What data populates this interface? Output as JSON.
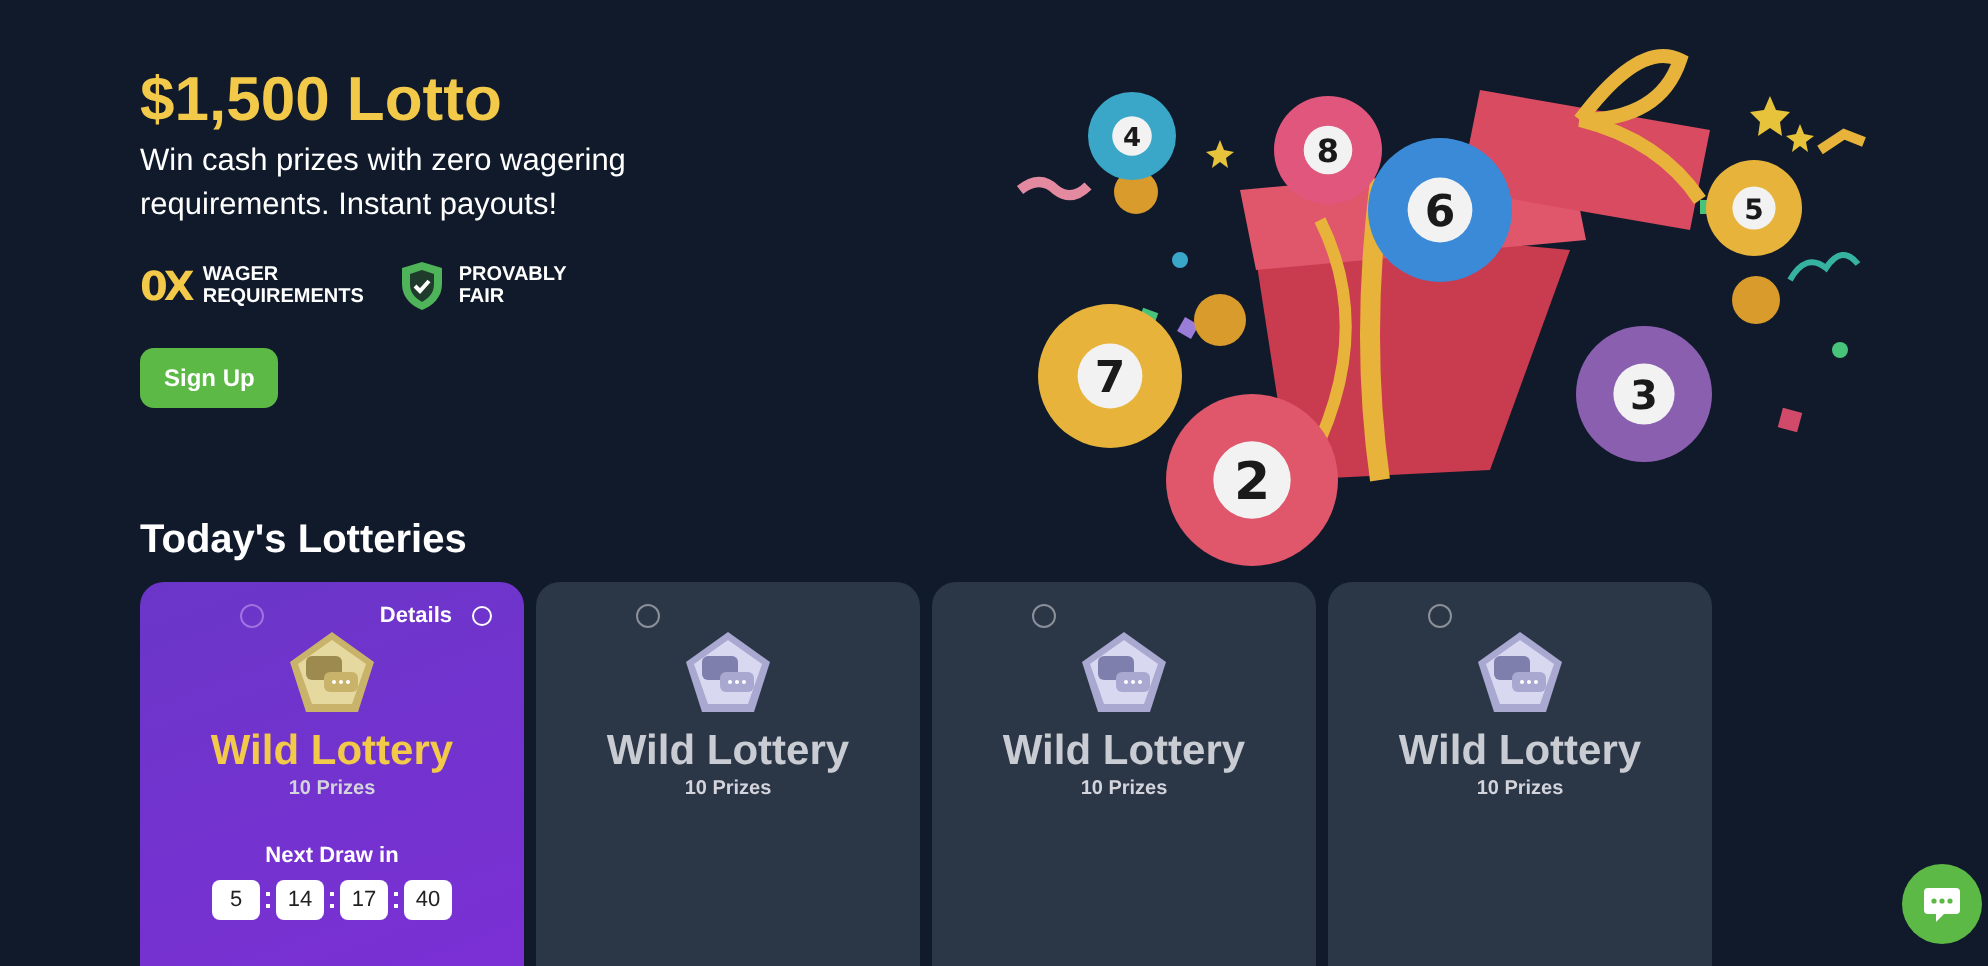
{
  "hero": {
    "title": "$1,500 Lotto",
    "subtitle": "Win cash prizes with zero wagering requirements. Instant payouts!",
    "features": [
      {
        "kind": "wager",
        "badge": "0X",
        "label": "WAGER REQUIREMENTS"
      },
      {
        "kind": "fair",
        "label": "PROVABLY FAIR"
      }
    ],
    "button": "Sign Up",
    "balls": [
      "4",
      "8",
      "6",
      "5",
      "7",
      "3",
      "2"
    ]
  },
  "section_title": "Today's Lotteries",
  "lotteries": [
    {
      "name": "Wild Lottery",
      "prizes": "10 Prizes",
      "selected": true,
      "details": "Details",
      "countdown_label": "Next Draw in",
      "countdown": [
        "5",
        "14",
        "17",
        "40"
      ]
    },
    {
      "name": "Wild Lottery",
      "prizes": "10 Prizes",
      "selected": false
    },
    {
      "name": "Wild Lottery",
      "prizes": "10 Prizes",
      "selected": false
    },
    {
      "name": "Wild Lottery",
      "prizes": "10 Prizes",
      "selected": false
    }
  ]
}
